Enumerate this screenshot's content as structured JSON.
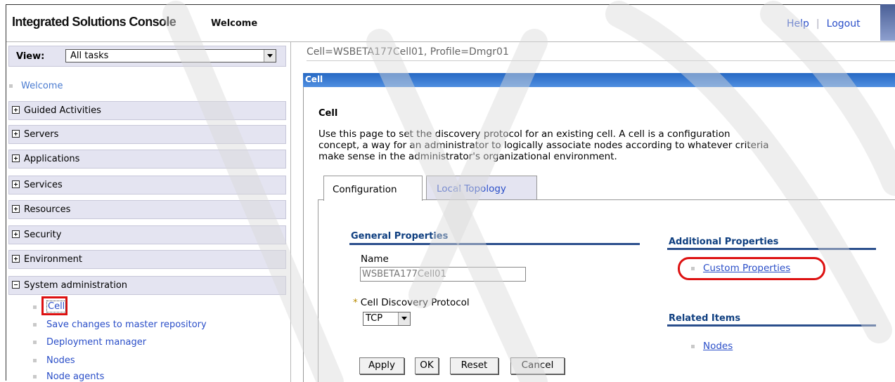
{
  "header": {
    "brand": "Integrated Solutions Console",
    "welcome": "Welcome",
    "help": "Help",
    "separator": "|",
    "logout": "Logout"
  },
  "nav": {
    "view_label": "View:",
    "view_value": "All tasks",
    "welcome_link": "Welcome",
    "groups": [
      {
        "label": "Guided Activities",
        "expanded": false
      },
      {
        "label": "Servers",
        "expanded": false
      },
      {
        "label": "Applications",
        "expanded": false
      },
      {
        "label": "Services",
        "expanded": false
      },
      {
        "label": "Resources",
        "expanded": false
      },
      {
        "label": "Security",
        "expanded": false
      },
      {
        "label": "Environment",
        "expanded": false
      },
      {
        "label": "System administration",
        "expanded": true
      }
    ],
    "sysadmin_items": [
      "Cell",
      "Save changes to master repository",
      "Deployment manager",
      "Nodes",
      "Node agents"
    ]
  },
  "main": {
    "breadcrumb": "Cell=WSBETA177Cell01, Profile=Dmgr01",
    "bar_title": "Cell",
    "heading": "Cell",
    "description_lines": [
      "Use this page to set the discovery protocol for an existing cell. A cell is a configuration",
      "concept, a way for an administrator to logically associate nodes according to whatever criteria",
      "make sense in the administrator's organizational environment."
    ],
    "tabs": [
      {
        "label": "Configuration",
        "active": true
      },
      {
        "label": "Local Topology",
        "active": false
      }
    ],
    "general_properties": "General Properties",
    "name_label": "Name",
    "name_value": "WSBETA177Cell01",
    "required_marker": "*",
    "protocol_label": "Cell Discovery Protocol",
    "protocol_value": "TCP",
    "buttons": {
      "apply": "Apply",
      "ok": "OK",
      "reset": "Reset",
      "cancel": "Cancel"
    },
    "additional_properties": "Additional Properties",
    "custom_properties": "Custom Properties",
    "related_items": "Related Items",
    "nodes_link": "Nodes"
  },
  "colors": {
    "accent_blue": "#2769c4",
    "nav_bg": "#e4e4f1",
    "link": "#2a4ec8",
    "highlight_red": "#dd1111",
    "section_rule": "#2a4e8c"
  },
  "icons": {
    "dropdown": "chevron-down-icon",
    "expand": "plus-box-icon",
    "collapse": "minus-box-icon",
    "bullet": "square-bullet-icon"
  }
}
